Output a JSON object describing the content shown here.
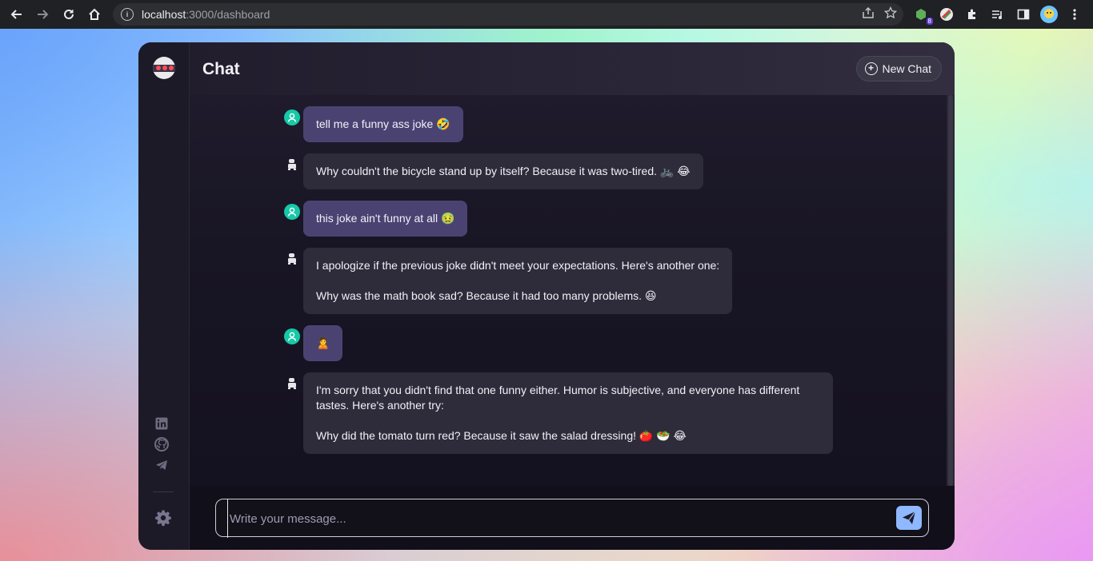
{
  "browser": {
    "url_host": "localhost",
    "url_path": ":3000/dashboard",
    "extension_badge": "8"
  },
  "app": {
    "title": "Chat",
    "new_chat_label": "New Chat"
  },
  "messages": [
    {
      "role": "user",
      "text": "tell me a funny ass joke 🤣"
    },
    {
      "role": "bot",
      "text": "Why couldn't the bicycle stand up by itself? Because it was two-tired. 🚲 😂"
    },
    {
      "role": "user",
      "text": "this joke ain't funny at all 🤢"
    },
    {
      "role": "bot",
      "text": "I apologize if the previous joke didn't meet your expectations. Here's another one:\n\nWhy was the math book sad? Because it had too many problems. 😆"
    },
    {
      "role": "user",
      "text": "🙎"
    },
    {
      "role": "bot",
      "text": "I'm sorry that you didn't find that one funny either. Humor is subjective, and everyone has different tastes. Here's another try:\n\nWhy did the tomato turn red? Because it saw the salad dressing! 🍅 🥗 😂"
    }
  ],
  "composer": {
    "placeholder": "Write your message..."
  }
}
